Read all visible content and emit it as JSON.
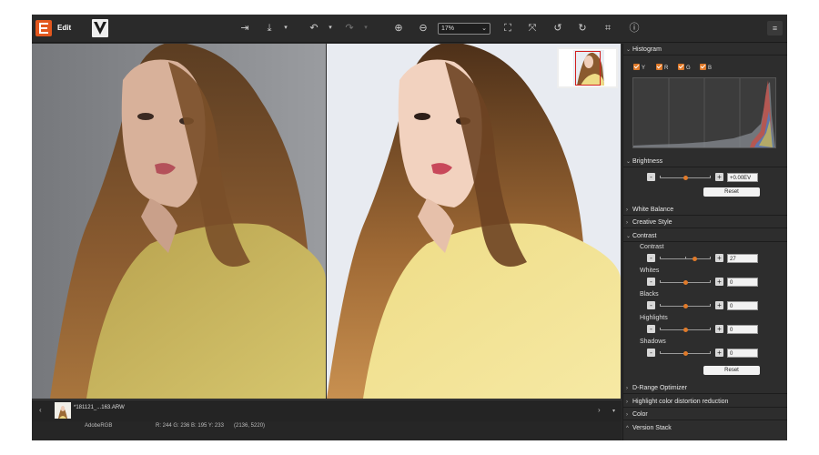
{
  "toolbar": {
    "mode_label": "Edit",
    "zoom_value": "17%"
  },
  "histogram": {
    "title": "Histogram",
    "channels": [
      {
        "label": "Y",
        "checked": true
      },
      {
        "label": "R",
        "checked": true
      },
      {
        "label": "G",
        "checked": true
      },
      {
        "label": "B",
        "checked": true
      }
    ]
  },
  "brightness": {
    "title": "Brightness",
    "value": "+0.00EV",
    "slider_level": 0.5,
    "reset_label": "Reset"
  },
  "sections": {
    "white_balance": "White Balance",
    "creative_style": "Creative Style",
    "contrast": "Contrast",
    "d_range": "D-Range Optimizer",
    "highlight_color": "Highlight color distortion reduction",
    "color": "Color",
    "version_stack": "Version Stack"
  },
  "contrast_panel": {
    "reset_label": "Reset",
    "sliders": [
      {
        "label": "Contrast",
        "value": "27",
        "level": 0.68
      },
      {
        "label": "Whites",
        "value": "0",
        "level": 0.5
      },
      {
        "label": "Blacks",
        "value": "0",
        "level": 0.5
      },
      {
        "label": "Highlights",
        "value": "0",
        "level": 0.5
      },
      {
        "label": "Shadows",
        "value": "0",
        "level": 0.5
      }
    ]
  },
  "filmstrip": {
    "file_name": "*181121_...163.ARW"
  },
  "status": {
    "color_space": "AdobeRGB",
    "readout": "R: 244  G: 236  B: 195  Y: 233",
    "coords": "(2136, 5220)"
  },
  "colors": {
    "accent": "#e07a2a",
    "panel_bg": "#2d2d2d",
    "logo": "#e2571e"
  }
}
